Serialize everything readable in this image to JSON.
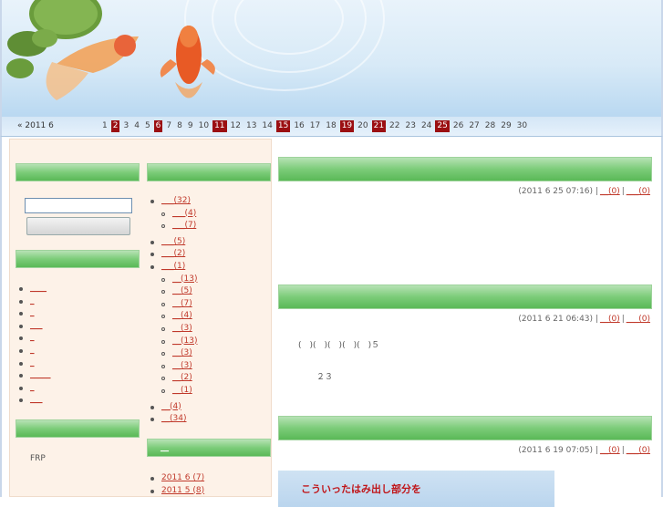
{
  "calendar": {
    "month_label": "« 2011 6",
    "days": [
      {
        "n": "1",
        "hl": false
      },
      {
        "n": "2",
        "hl": true
      },
      {
        "n": "3",
        "hl": false
      },
      {
        "n": "4",
        "hl": false
      },
      {
        "n": "5",
        "hl": false
      },
      {
        "n": "6",
        "hl": true
      },
      {
        "n": "7",
        "hl": false
      },
      {
        "n": "8",
        "hl": false
      },
      {
        "n": "9",
        "hl": false
      },
      {
        "n": "10",
        "hl": false
      },
      {
        "n": "11",
        "hl": true
      },
      {
        "n": "12",
        "hl": false
      },
      {
        "n": "13",
        "hl": false
      },
      {
        "n": "14",
        "hl": false
      },
      {
        "n": "15",
        "hl": true
      },
      {
        "n": "16",
        "hl": false
      },
      {
        "n": "17",
        "hl": false
      },
      {
        "n": "18",
        "hl": false
      },
      {
        "n": "19",
        "hl": true
      },
      {
        "n": "20",
        "hl": false
      },
      {
        "n": "21",
        "hl": true
      },
      {
        "n": "22",
        "hl": false
      },
      {
        "n": "23",
        "hl": false
      },
      {
        "n": "24",
        "hl": false
      },
      {
        "n": "25",
        "hl": true
      },
      {
        "n": "26",
        "hl": false
      },
      {
        "n": "27",
        "hl": false
      },
      {
        "n": "28",
        "hl": false
      },
      {
        "n": "29",
        "hl": false
      },
      {
        "n": "30",
        "hl": false
      }
    ]
  },
  "sidebar_left": {
    "link_items": [
      "____",
      "_",
      "_",
      "___",
      "_",
      "_",
      "_",
      "_____",
      "_",
      "___"
    ],
    "frp_text": "FRP"
  },
  "sidebar_right": {
    "categories": [
      {
        "label": "___(32)",
        "level": 0
      },
      {
        "label": "___(4)",
        "level": 1
      },
      {
        "label": "___(7)",
        "level": 1
      },
      {
        "label": "___(5)",
        "level": 0
      },
      {
        "label": "___(2)",
        "level": 0
      },
      {
        "label": "___(1)",
        "level": 0
      },
      {
        "label": "__(13)",
        "level": 1
      },
      {
        "label": "__(5)",
        "level": 1
      },
      {
        "label": "__(7)",
        "level": 1
      },
      {
        "label": "__(4)",
        "level": 1
      },
      {
        "label": "__(3)",
        "level": 1
      },
      {
        "label": "__(13)",
        "level": 1
      },
      {
        "label": "__(3)",
        "level": 1
      },
      {
        "label": "__(3)",
        "level": 1
      },
      {
        "label": "__(2)",
        "level": 1
      },
      {
        "label": "__(1)",
        "level": 1
      },
      {
        "label": "__(4)",
        "level": 0
      },
      {
        "label": "__(34)",
        "level": 0
      }
    ],
    "archive_header": "__",
    "archives": [
      "2011 6 (7)",
      "2011 5 (8)"
    ]
  },
  "posts": [
    {
      "meta": "(2011 6 25  07:16) |",
      "link1": "__(0)",
      "link2": "___(0)",
      "body_lines": []
    },
    {
      "meta": "(2011 6 21  06:43) |",
      "link1": "__(0)",
      "link2": "___(0)",
      "body_lines": [
        "(　)(　)(　)(　)(　)５",
        "２３"
      ]
    },
    {
      "meta": "(2011 6 19  07:05) |",
      "link1": "__(0)",
      "link2": "___(0)",
      "body_lines": []
    }
  ],
  "bubble_text": "こういったはみ出し部分を"
}
